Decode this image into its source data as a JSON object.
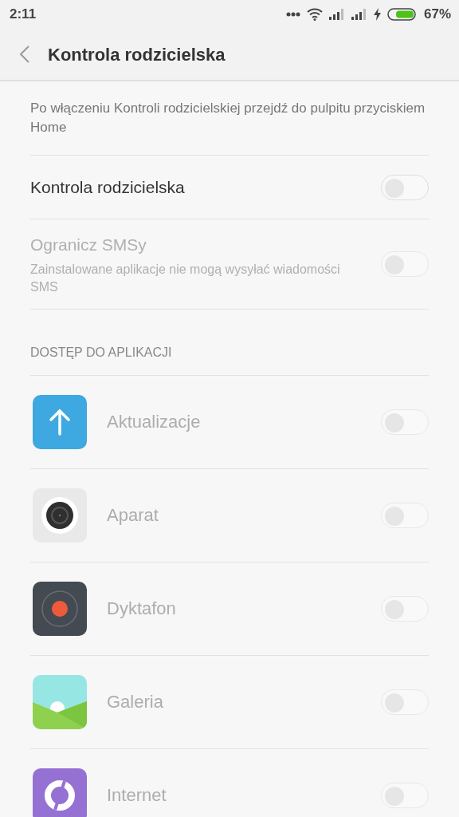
{
  "status_bar": {
    "time": "2:11",
    "battery": "67%"
  },
  "header": {
    "title": "Kontrola rodzicielska"
  },
  "intro": "Po włączeniu Kontroli rodzicielskiej przejdź do pulpitu przyciskiem Home",
  "settings": [
    {
      "label": "Kontrola rodzicielska",
      "on": false,
      "disabled": false
    },
    {
      "label": "Ogranicz SMSy",
      "description": "Zainstalowane aplikacje nie mogą wysyłać wiadomości SMS",
      "on": false,
      "disabled": true
    }
  ],
  "section_title": "DOSTĘP DO APLIKACJI",
  "apps": [
    {
      "kind": "update",
      "label": "Aktualizacje",
      "on": false,
      "disabled": true
    },
    {
      "kind": "camera",
      "label": "Aparat",
      "on": false,
      "disabled": true
    },
    {
      "kind": "recorder",
      "label": "Dyktafon",
      "on": false,
      "disabled": true
    },
    {
      "kind": "gallery",
      "label": "Galeria",
      "on": false,
      "disabled": true
    },
    {
      "kind": "browser",
      "label": "Internet",
      "on": false,
      "disabled": true
    }
  ]
}
